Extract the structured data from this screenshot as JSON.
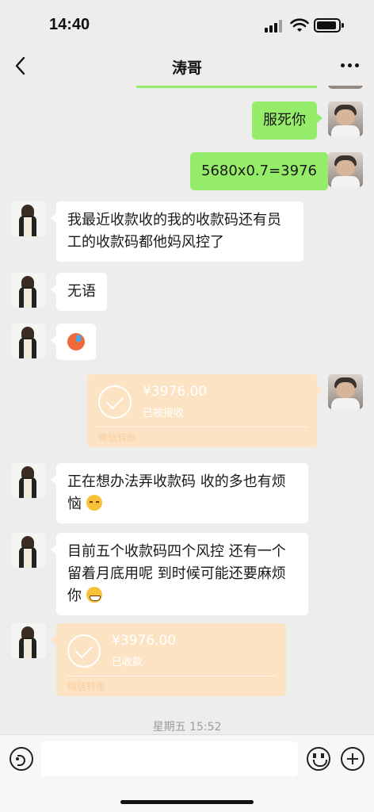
{
  "status_bar": {
    "time": "14:40"
  },
  "header": {
    "title": "涛哥",
    "back_icon": "chevron-left-icon",
    "more_icon": "more-dots-icon"
  },
  "messages": [
    {
      "from": "me",
      "type": "text",
      "text": "服死你"
    },
    {
      "from": "me",
      "type": "text",
      "text": "5680x0.7=3976"
    },
    {
      "from": "other",
      "type": "text",
      "lines": [
        "我最近收款收的我的收款码还有员",
        "工的收款码都他妈风控了"
      ]
    },
    {
      "from": "other",
      "type": "text",
      "text": "无语"
    },
    {
      "from": "other",
      "type": "emoji",
      "emoji": "angry-face"
    },
    {
      "from": "me",
      "type": "transfer",
      "amount": "¥3976.00",
      "status": "已被接收",
      "source": "微信转账"
    },
    {
      "from": "other",
      "type": "text",
      "lines": [
        "正在想办法弄收款码 收的多也有烦",
        "恼"
      ],
      "emoji": "tired-face"
    },
    {
      "from": "other",
      "type": "text",
      "lines": [
        "目前五个收款码四个风控 还有一个",
        "留着月底用呢 到时候可能还要麻烦",
        "你"
      ],
      "emoji": "grin-face"
    },
    {
      "from": "other",
      "type": "transfer",
      "amount": "¥3976.00",
      "status": "已收款",
      "source": "微信转账"
    }
  ],
  "timestamp": "星期五 15:52",
  "input_bar": {
    "voice_icon": "voice-icon",
    "emoji_icon": "emoji-icon",
    "plus_icon": "plus-icon"
  },
  "colors": {
    "background": "#ededed",
    "out_bubble": "#95ec69",
    "in_bubble": "#ffffff",
    "transfer": "#fce3c3"
  }
}
